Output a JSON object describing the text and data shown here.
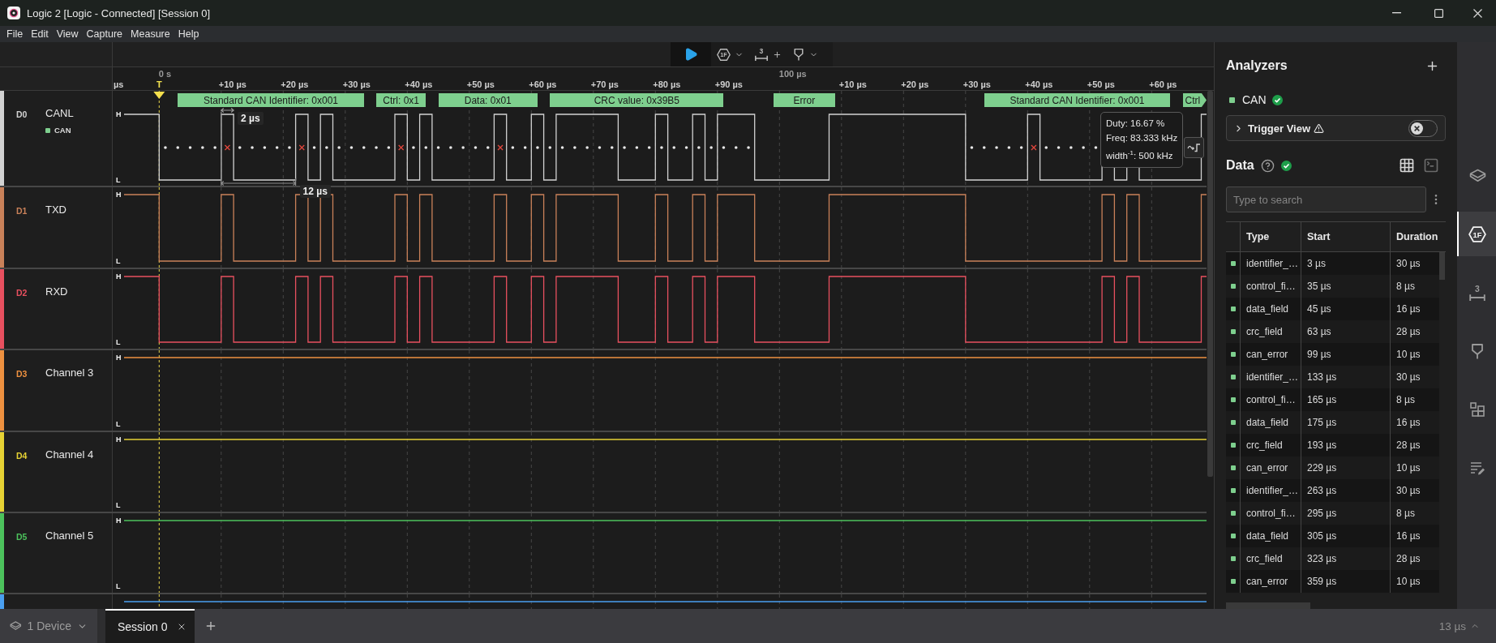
{
  "window": {
    "title": "Logic 2 [Logic - Connected] [Session 0]"
  },
  "menu": [
    "File",
    "Edit",
    "View",
    "Capture",
    "Measure",
    "Help"
  ],
  "toolbar": [
    {
      "kind": "play"
    },
    {
      "kind": "trigger",
      "glyph": "1F"
    },
    {
      "kind": "measure",
      "glyph": "3"
    },
    {
      "kind": "marker"
    }
  ],
  "timeline": {
    "origins": [
      "0 s",
      "100 µs"
    ],
    "trigger_label": "T",
    "ticks": [
      "µs",
      "+10 µs",
      "+20 µs",
      "+30 µs",
      "+40 µs",
      "+50 µs",
      "+60 µs",
      "+70 µs",
      "+80 µs",
      "+90 µs",
      "+10 µs",
      "+20 µs",
      "+30 µs",
      "+40 µs",
      "+50 µs",
      "+60 µs"
    ]
  },
  "channels": [
    {
      "id": "D0",
      "name": "CANL",
      "kind": "bus",
      "color": "#d2d2d2",
      "high_label": "H",
      "low_label": "L",
      "analyzer": "CAN",
      "annotations": [
        "Standard CAN Identifier: 0x001",
        "Ctrl: 0x1",
        "Data: 0x01",
        "CRC value: 0x39B5",
        "Error",
        "Standard CAN Identifier: 0x001",
        "Ctrl"
      ],
      "measurements": [
        "2 µs",
        "12 µs"
      ],
      "tooltip": [
        "Duty: 16.67 %",
        "Freq: 83.333 kHz",
        "width$^{-1}$: 500 kHz"
      ]
    },
    {
      "id": "D1",
      "name": "TXD",
      "kind": "line",
      "color": "#c98159",
      "high_label": "H",
      "low_label": "L"
    },
    {
      "id": "D2",
      "name": "RXD",
      "kind": "line",
      "color": "#e8505f",
      "high_label": "H",
      "low_label": "L"
    },
    {
      "id": "D3",
      "name": "Channel 3",
      "kind": "idle",
      "color": "#ee9140",
      "high_label": "H",
      "low_label": "L"
    },
    {
      "id": "D4",
      "name": "Channel 4",
      "kind": "idle",
      "color": "#e6d234",
      "high_label": "H",
      "low_label": "L"
    },
    {
      "id": "D5",
      "name": "Channel 5",
      "kind": "idle",
      "color": "#4cc25c",
      "high_label": "H",
      "low_label": "L"
    },
    {
      "kind": "idle",
      "color": "#4a9ff0"
    }
  ],
  "analyzers": {
    "title": "Analyzers",
    "items": [
      {
        "name": "CAN",
        "color": "#7ecf8e",
        "ok": true
      }
    ],
    "trigger_view": {
      "label": "Trigger View",
      "expanded": false,
      "on": false
    }
  },
  "data": {
    "title": "Data",
    "ok": true,
    "views": [
      {
        "kind": "table",
        "selected": true
      },
      {
        "kind": "terminal",
        "selected": false
      }
    ],
    "search": {
      "placeholder": "Type to search"
    },
    "columns": [
      "Type",
      "Start",
      "Duration"
    ],
    "rows": [
      {
        "type": "identifier_…",
        "start": "3 µs",
        "duration": "30 µs"
      },
      {
        "type": "control_fi…",
        "start": "35 µs",
        "duration": "8 µs"
      },
      {
        "type": "data_field",
        "start": "45 µs",
        "duration": "16 µs"
      },
      {
        "type": "crc_field",
        "start": "63 µs",
        "duration": "28 µs"
      },
      {
        "type": "can_error",
        "start": "99 µs",
        "duration": "10 µs"
      },
      {
        "type": "identifier_…",
        "start": "133 µs",
        "duration": "30 µs"
      },
      {
        "type": "control_fi…",
        "start": "165 µs",
        "duration": "8 µs"
      },
      {
        "type": "data_field",
        "start": "175 µs",
        "duration": "16 µs"
      },
      {
        "type": "crc_field",
        "start": "193 µs",
        "duration": "28 µs"
      },
      {
        "type": "can_error",
        "start": "229 µs",
        "duration": "10 µs"
      },
      {
        "type": "identifier_…",
        "start": "263 µs",
        "duration": "30 µs"
      },
      {
        "type": "control_fi…",
        "start": "295 µs",
        "duration": "8 µs"
      },
      {
        "type": "data_field",
        "start": "305 µs",
        "duration": "16 µs"
      },
      {
        "type": "crc_field",
        "start": "323 µs",
        "duration": "28 µs"
      },
      {
        "type": "can_error",
        "start": "359 µs",
        "duration": "10 µs"
      }
    ]
  },
  "side_tabs": [
    {
      "kind": "device",
      "selected": false
    },
    {
      "kind": "analyzers",
      "glyph": "1F",
      "selected": true
    },
    {
      "kind": "measure",
      "glyph": "3",
      "selected": false
    },
    {
      "kind": "marker",
      "selected": false
    },
    {
      "kind": "extensions",
      "selected": false
    },
    {
      "kind": "notes",
      "selected": false
    }
  ],
  "bottom_bar": {
    "device": "1 Device",
    "sessions": [
      {
        "label": "Session 0",
        "selected": true
      }
    ],
    "zoom": "13 µs"
  }
}
